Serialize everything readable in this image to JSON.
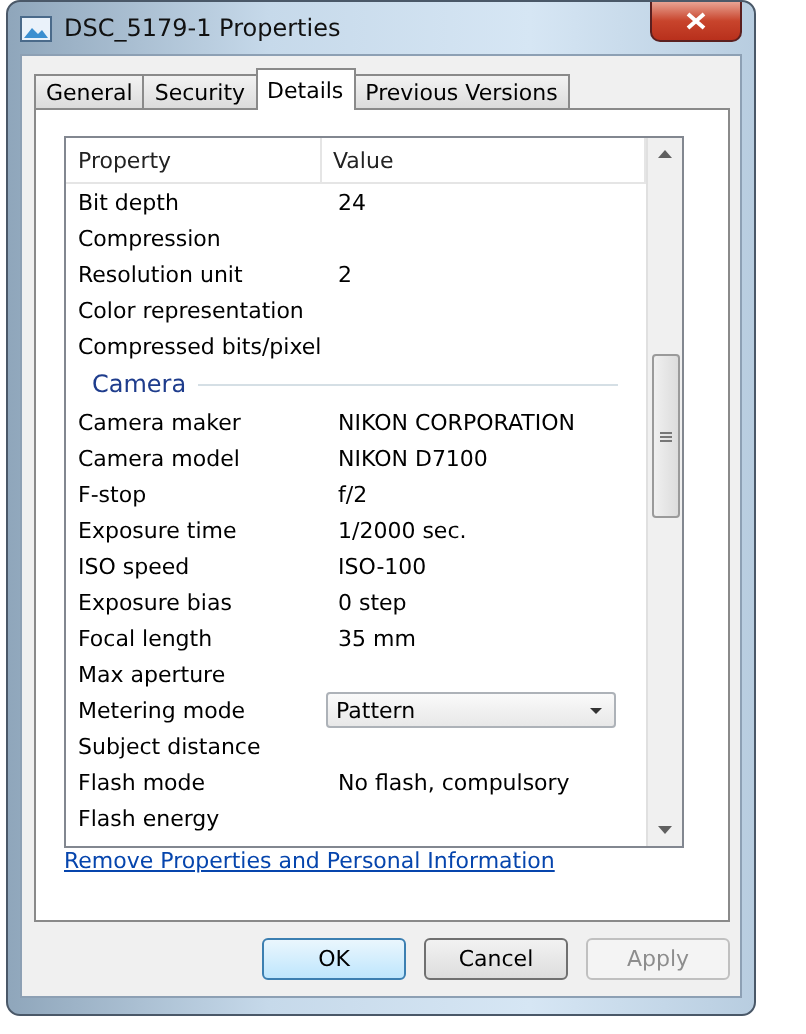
{
  "window": {
    "title": "DSC_5179-1 Properties"
  },
  "tabs": [
    {
      "label": "General",
      "selected": false
    },
    {
      "label": "Security",
      "selected": false
    },
    {
      "label": "Details",
      "selected": true
    },
    {
      "label": "Previous Versions",
      "selected": false
    }
  ],
  "table": {
    "columns": [
      "Property",
      "Value"
    ],
    "rows": [
      {
        "kind": "property",
        "name": "Bit depth",
        "value": "24"
      },
      {
        "kind": "property",
        "name": "Compression"
      },
      {
        "kind": "property",
        "name": "Resolution unit",
        "value": "2"
      },
      {
        "kind": "property",
        "name": "Color representation"
      },
      {
        "kind": "property",
        "name": "Compressed bits/pixel"
      },
      {
        "kind": "group",
        "name": "Camera"
      },
      {
        "kind": "property",
        "name": "Camera maker",
        "value": "NIKON CORPORATION"
      },
      {
        "kind": "property",
        "name": "Camera model",
        "value": "NIKON D7100"
      },
      {
        "kind": "property",
        "name": "F-stop",
        "value": "f/2"
      },
      {
        "kind": "property",
        "name": "Exposure time",
        "value": "1/2000 sec."
      },
      {
        "kind": "property",
        "name": "ISO speed",
        "value": "ISO-100"
      },
      {
        "kind": "property",
        "name": "Exposure bias",
        "value": "0 step"
      },
      {
        "kind": "property",
        "name": "Focal length",
        "value": "35 mm"
      },
      {
        "kind": "property",
        "name": "Max aperture"
      },
      {
        "kind": "dropdown",
        "name": "Metering mode",
        "value": "Pattern"
      },
      {
        "kind": "property",
        "name": "Subject distance"
      },
      {
        "kind": "property",
        "name": "Flash mode",
        "value": "No flash, compulsory"
      },
      {
        "kind": "property",
        "name": "Flash energy"
      }
    ]
  },
  "link": "Remove Properties and Personal Information",
  "buttons": [
    {
      "label": "OK",
      "default": true,
      "disabled": false
    },
    {
      "label": "Cancel",
      "default": false,
      "disabled": false
    },
    {
      "label": "Apply",
      "default": false,
      "disabled": true
    }
  ]
}
